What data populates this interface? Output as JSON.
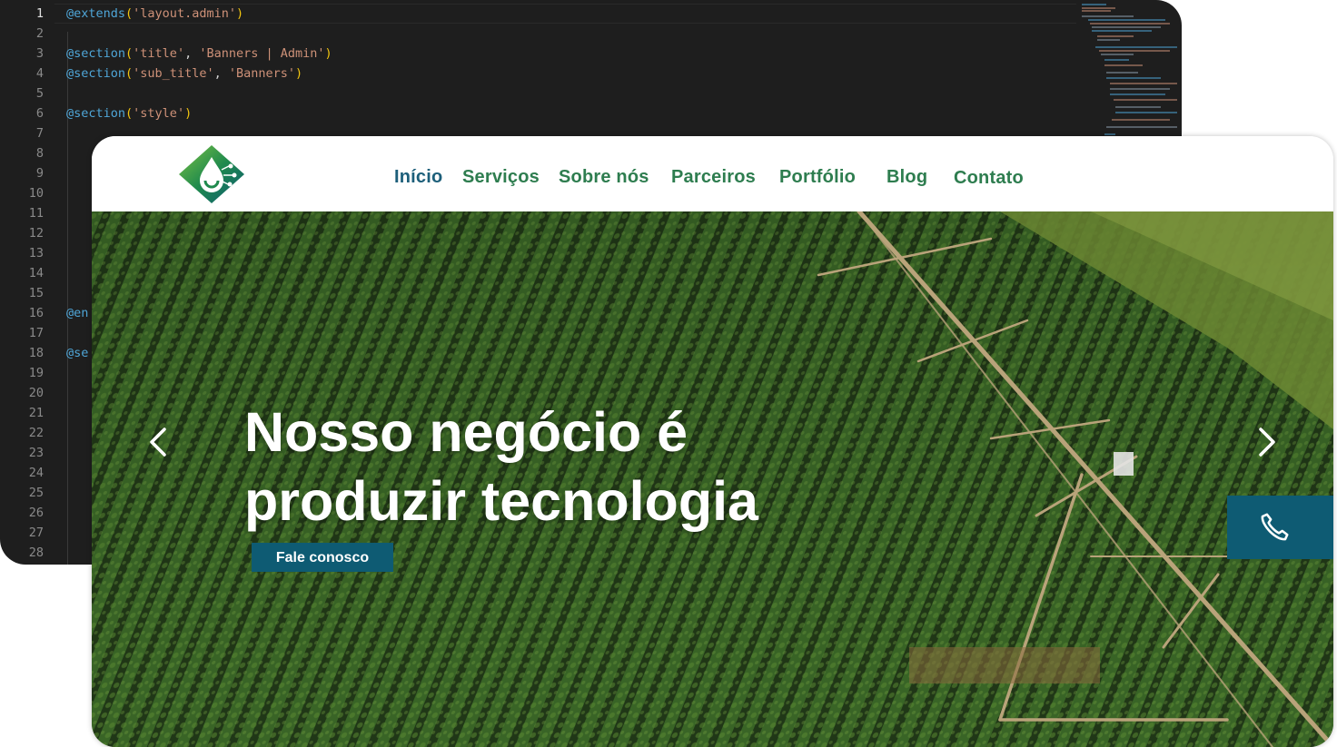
{
  "editor": {
    "line_numbers": [
      "1",
      "2",
      "3",
      "4",
      "5",
      "6",
      "7",
      "8",
      "9",
      "10",
      "11",
      "12",
      "13",
      "14",
      "15",
      "16",
      "17",
      "18",
      "19",
      "20",
      "21",
      "22",
      "23",
      "24",
      "25",
      "26",
      "27",
      "28"
    ],
    "lines": [
      {
        "kw": "@extends",
        "p1": "(",
        "str": "'layout.admin'",
        "p2": ")"
      },
      {
        "kw": "@section",
        "p1": "(",
        "str": "'title'",
        "sep": ", ",
        "str2": "'Banners | Admin'",
        "p2": ")"
      },
      {
        "kw": "@section",
        "p1": "(",
        "str": "'sub_title'",
        "sep": ", ",
        "str2": "'Banners'",
        "p2": ")"
      },
      {
        "kw": "@section",
        "p1": "(",
        "str": "'style'",
        "p2": ")"
      },
      {
        "kw": "@en"
      },
      {
        "kw": "@se"
      }
    ]
  },
  "site": {
    "nav": {
      "items": [
        "Início",
        "Serviços",
        "Sobre nós",
        "Parceiros",
        "Portfólio",
        "Blog",
        "Contato"
      ]
    },
    "hero": {
      "title_line1": "Nosso negócio é",
      "title_line2": "produzir tecnologia",
      "cta_label": "Fale conosco"
    }
  },
  "colors": {
    "editor_bg": "#1e1e1e",
    "keyword": "#4fa6d8",
    "string": "#ce9178",
    "paren": "#f1c40f",
    "nav_green": "#2e7d4f",
    "nav_active": "#1d5f7a",
    "cta_bg": "#0e5b73"
  },
  "icons": {
    "prev": "chevron-left-icon",
    "next": "chevron-right-icon",
    "phone": "phone-icon",
    "logo": "logo-icon"
  }
}
